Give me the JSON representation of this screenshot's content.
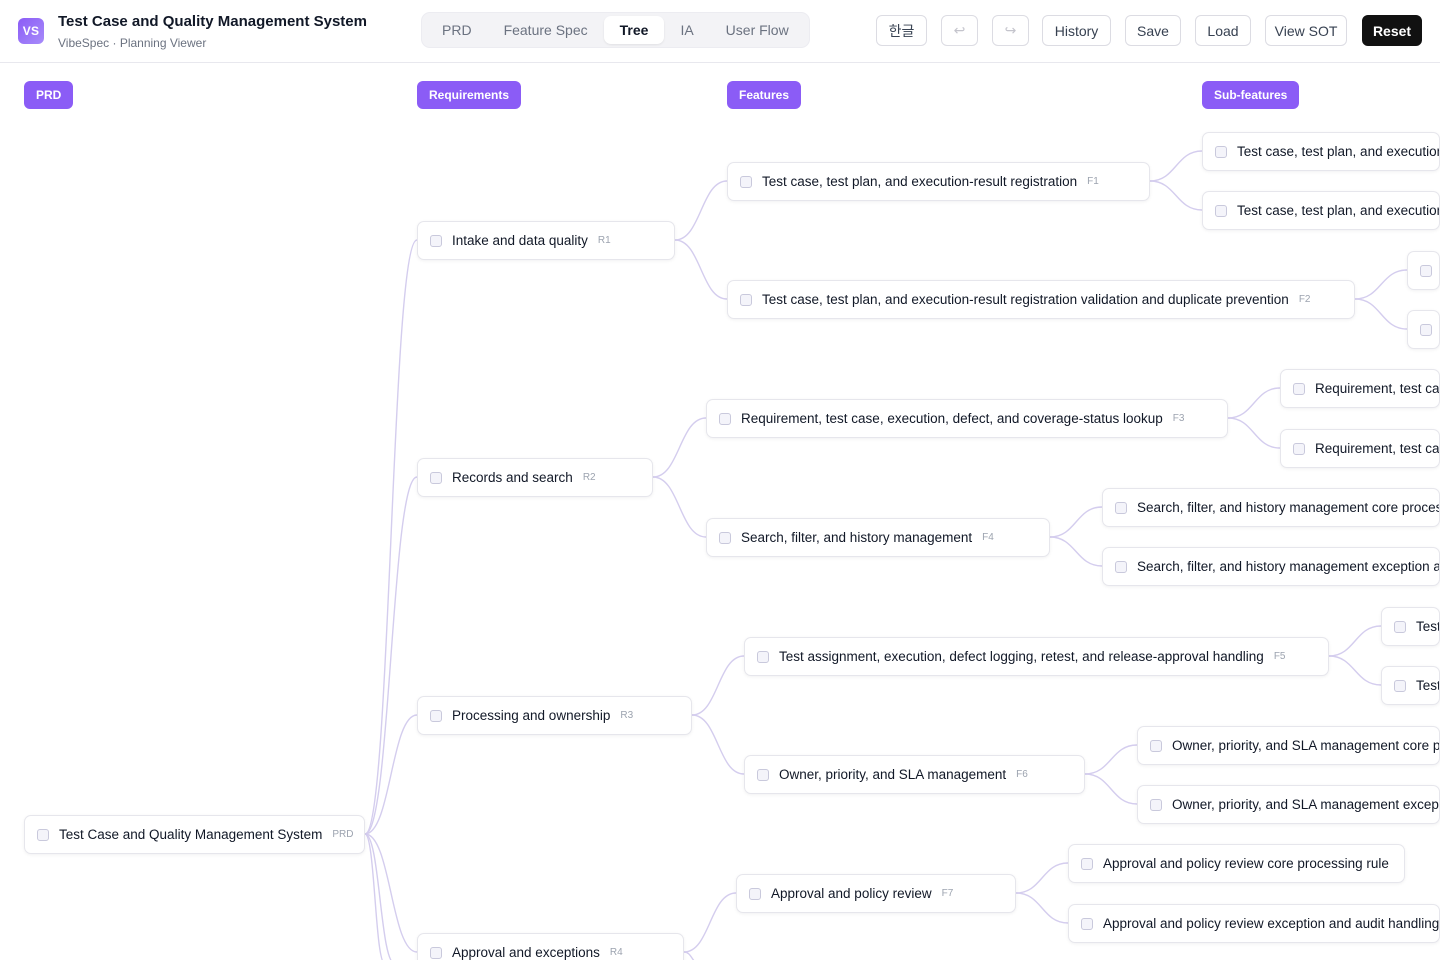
{
  "header": {
    "logo": "VS",
    "title": "Test Case and Quality Management System",
    "subtitle": "VibeSpec · Planning Viewer"
  },
  "tabs": [
    {
      "label": "PRD",
      "active": false
    },
    {
      "label": "Feature Spec",
      "active": false
    },
    {
      "label": "Tree",
      "active": true
    },
    {
      "label": "IA",
      "active": false
    },
    {
      "label": "User Flow",
      "active": false
    }
  ],
  "toolbar": {
    "language": "한글",
    "undo_icon": "↩",
    "redo_icon": "↪",
    "history": "History",
    "save": "Save",
    "load": "Load",
    "view_sot": "View SOT",
    "reset": "Reset"
  },
  "columns": {
    "prd": "PRD",
    "requirements": "Requirements",
    "features": "Features",
    "subfeatures": "Sub-features"
  },
  "tree": {
    "root": {
      "label": "Test Case and Quality Management System",
      "code": "PRD"
    },
    "requirements": [
      {
        "label": "Intake and data quality",
        "code": "R1"
      },
      {
        "label": "Records and search",
        "code": "R2"
      },
      {
        "label": "Processing and ownership",
        "code": "R3"
      },
      {
        "label": "Approval and exceptions",
        "code": "R4"
      }
    ],
    "features": [
      {
        "label": "Test case, test plan, and execution-result registration",
        "code": "F1"
      },
      {
        "label": "Test case, test plan, and execution-result registration validation and duplicate prevention",
        "code": "F2"
      },
      {
        "label": "Requirement, test case, execution, defect, and coverage-status lookup",
        "code": "F3"
      },
      {
        "label": "Search, filter, and history management",
        "code": "F4"
      },
      {
        "label": "Test assignment, execution, defect logging, retest, and release-approval handling",
        "code": "F5"
      },
      {
        "label": "Owner, priority, and SLA management",
        "code": "F6"
      },
      {
        "label": "Approval and policy review",
        "code": "F7"
      }
    ],
    "subfeatures": [
      {
        "label": "Test case, test plan, and execution-re"
      },
      {
        "label": "Test case, test plan, and execution-re"
      },
      {
        "label": ""
      },
      {
        "label": ""
      },
      {
        "label": "Requirement, test case"
      },
      {
        "label": "Requirement, test case"
      },
      {
        "label": "Search, filter, and history management core processin"
      },
      {
        "label": "Search, filter, and history management exception and"
      },
      {
        "label": "Test"
      },
      {
        "label": "Test"
      },
      {
        "label": "Owner, priority, and SLA management core proc"
      },
      {
        "label": "Owner, priority, and SLA management exceptior"
      },
      {
        "label": "Approval and policy review core processing rule"
      },
      {
        "label": "Approval and policy review exception and audit handling"
      }
    ]
  },
  "colors": {
    "accent": "#8b5cf6",
    "edge": "#d4cdee",
    "dark_button": "#111111"
  }
}
